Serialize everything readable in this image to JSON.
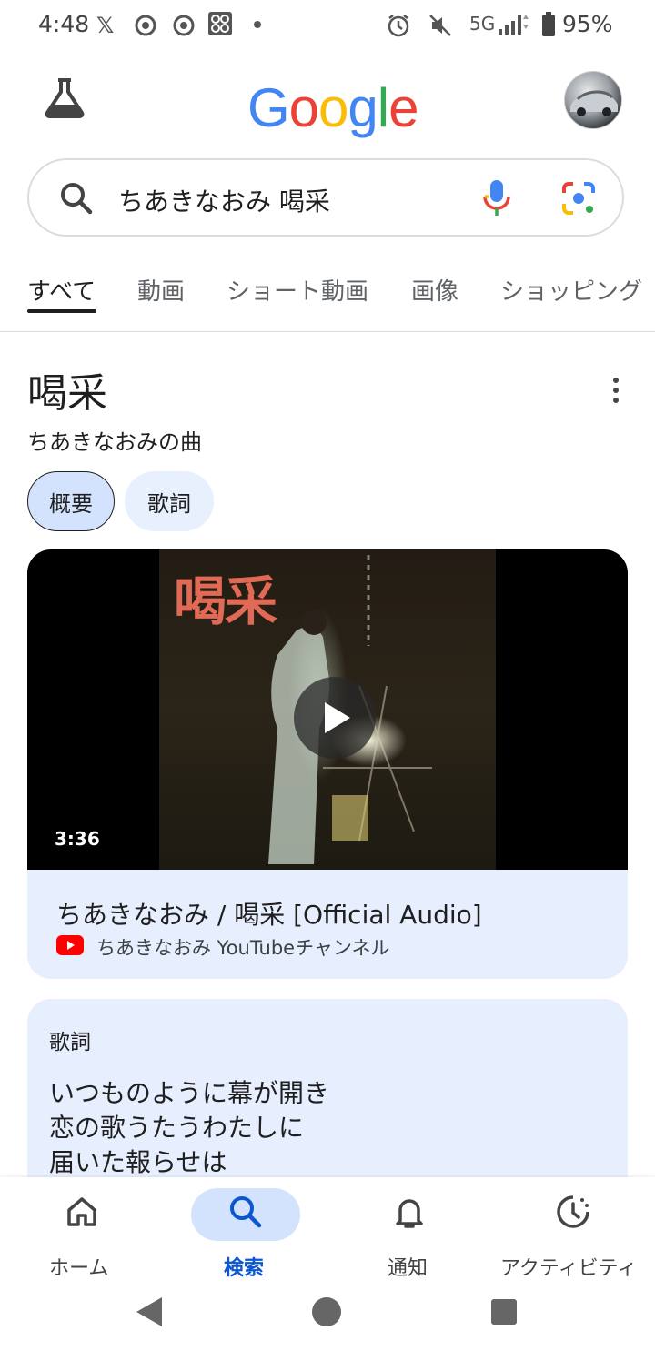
{
  "status_bar": {
    "time": "4:48",
    "network": "5G",
    "battery": "95%"
  },
  "header": {
    "logo_letters": [
      {
        "ch": "G",
        "color": "#4285F4"
      },
      {
        "ch": "o",
        "color": "#EA4335"
      },
      {
        "ch": "o",
        "color": "#FBBC05"
      },
      {
        "ch": "g",
        "color": "#4285F4"
      },
      {
        "ch": "l",
        "color": "#34A853"
      },
      {
        "ch": "e",
        "color": "#EA4335"
      }
    ]
  },
  "search": {
    "query": "ちあきなおみ 喝采"
  },
  "tabs": [
    {
      "label": "すべて",
      "active": true
    },
    {
      "label": "動画"
    },
    {
      "label": "ショート動画"
    },
    {
      "label": "画像"
    },
    {
      "label": "ショッピング"
    }
  ],
  "knowledge": {
    "title": "喝采",
    "subtitle": "ちあきなおみの曲",
    "chips": [
      "概要",
      "歌詞"
    ]
  },
  "video": {
    "thumb_title": "喝采",
    "duration": "3:36",
    "title": "ちあきなおみ / 喝采 [Official Audio]",
    "channel": "ちあきなおみ YouTubeチャンネル"
  },
  "lyrics": {
    "heading": "歌詞",
    "lines": [
      "いつものように幕が開き",
      "恋の歌うたうわたしに",
      "届いた報らせは"
    ]
  },
  "bottom_nav": [
    {
      "label": "ホーム",
      "icon": "home-icon"
    },
    {
      "label": "検索",
      "icon": "search-icon",
      "active": true
    },
    {
      "label": "通知",
      "icon": "bell-icon"
    },
    {
      "label": "アクティビティ",
      "icon": "activity-icon"
    }
  ],
  "colors": {
    "accent": "#0b57d0",
    "chip_bg": "#d3e3fd",
    "card_bg": "#e7eefe"
  }
}
